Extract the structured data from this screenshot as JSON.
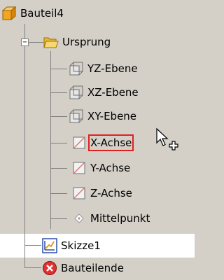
{
  "tree": {
    "root": {
      "label": "Bauteil4",
      "icon": "part-cube-icon"
    },
    "origin_folder": {
      "label": "Ursprung",
      "icon": "folder-open-icon",
      "expander": "−"
    },
    "origin_items": [
      {
        "label": "YZ-Ebene",
        "icon": "work-plane-icon"
      },
      {
        "label": "XZ-Ebene",
        "icon": "work-plane-icon"
      },
      {
        "label": "XY-Ebene",
        "icon": "work-plane-icon"
      },
      {
        "label": "X-Achse",
        "icon": "work-axis-icon",
        "state": "selected"
      },
      {
        "label": "Y-Achse",
        "icon": "work-axis-icon"
      },
      {
        "label": "Z-Achse",
        "icon": "work-axis-icon"
      },
      {
        "label": "Mittelpunkt",
        "icon": "work-point-icon"
      }
    ],
    "sketch": {
      "label": "Skizze1",
      "icon": "sketch-icon"
    },
    "end_of_part": {
      "label": "Bauteilende",
      "icon": "end-of-part-icon"
    }
  },
  "colors": {
    "background": "#d4d0c8",
    "band_highlight": "#ffffff",
    "selection_outline": "#e02020",
    "folder": "#f0c850",
    "cube": "#f2a51f",
    "end_marker": "#e03030"
  },
  "cursor": {
    "icon": "move-cursor-icon"
  }
}
